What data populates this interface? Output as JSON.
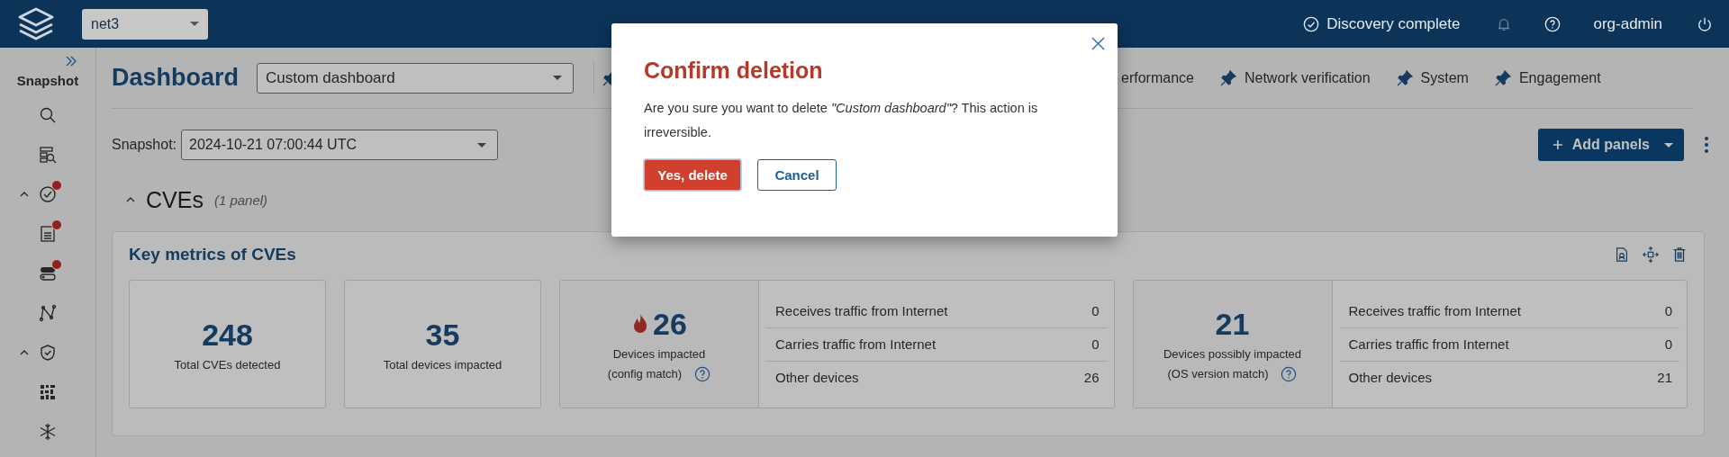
{
  "topbar": {
    "network": "net3",
    "status": "Discovery complete",
    "user": "org-admin"
  },
  "sidebar": {
    "title": "Snapshot",
    "items": [
      {
        "kind": "search",
        "alert": false
      },
      {
        "kind": "inventory",
        "alert": false
      },
      {
        "kind": "check",
        "alert": true,
        "expanded": true
      },
      {
        "kind": "document",
        "alert": true
      },
      {
        "kind": "toggle",
        "alert": true
      },
      {
        "kind": "path",
        "alert": false
      },
      {
        "kind": "shield",
        "alert": false,
        "expanded": true
      },
      {
        "kind": "grid",
        "alert": false
      },
      {
        "kind": "snowflake",
        "alert": false
      }
    ]
  },
  "header": {
    "title": "Dashboard",
    "dashboard": "Custom dashboard",
    "pinned_tabs": [
      {
        "label": "erformance"
      },
      {
        "label": "Network verification"
      },
      {
        "label": "System"
      },
      {
        "label": "Engagement"
      }
    ]
  },
  "snapshot": {
    "label": "Snapshot:",
    "value": "2024-10-21 07:00:44 UTC"
  },
  "add_panels": "Add panels",
  "section": {
    "title": "CVEs",
    "count": "(1 panel)",
    "expanded": true
  },
  "panel": {
    "title": "Key metrics of CVEs",
    "metrics": [
      {
        "kind": "simple",
        "value": "248",
        "label": "Total CVEs detected"
      },
      {
        "kind": "simple",
        "value": "35",
        "label": "Total devices impacted"
      },
      {
        "kind": "breakdown",
        "value": "26",
        "flame": true,
        "label": "Devices impacted",
        "sublabel": "(config match)",
        "rows": [
          {
            "label": "Receives traffic from Internet",
            "value": "0"
          },
          {
            "label": "Carries traffic from Internet",
            "value": "0"
          },
          {
            "label": "Other devices",
            "value": "26"
          }
        ]
      },
      {
        "kind": "breakdown",
        "value": "21",
        "flame": false,
        "label": "Devices possibly impacted",
        "sublabel": "(OS version match)",
        "rows": [
          {
            "label": "Receives traffic from Internet",
            "value": "0"
          },
          {
            "label": "Carries traffic from Internet",
            "value": "0"
          },
          {
            "label": "Other devices",
            "value": "21"
          }
        ]
      }
    ]
  },
  "dialog": {
    "title": "Confirm deletion",
    "message": "Are you sure you want to delete *\"Custom dashboard\"*? This action is irreversible.",
    "confirm": "Yes, delete",
    "cancel": "Cancel"
  }
}
